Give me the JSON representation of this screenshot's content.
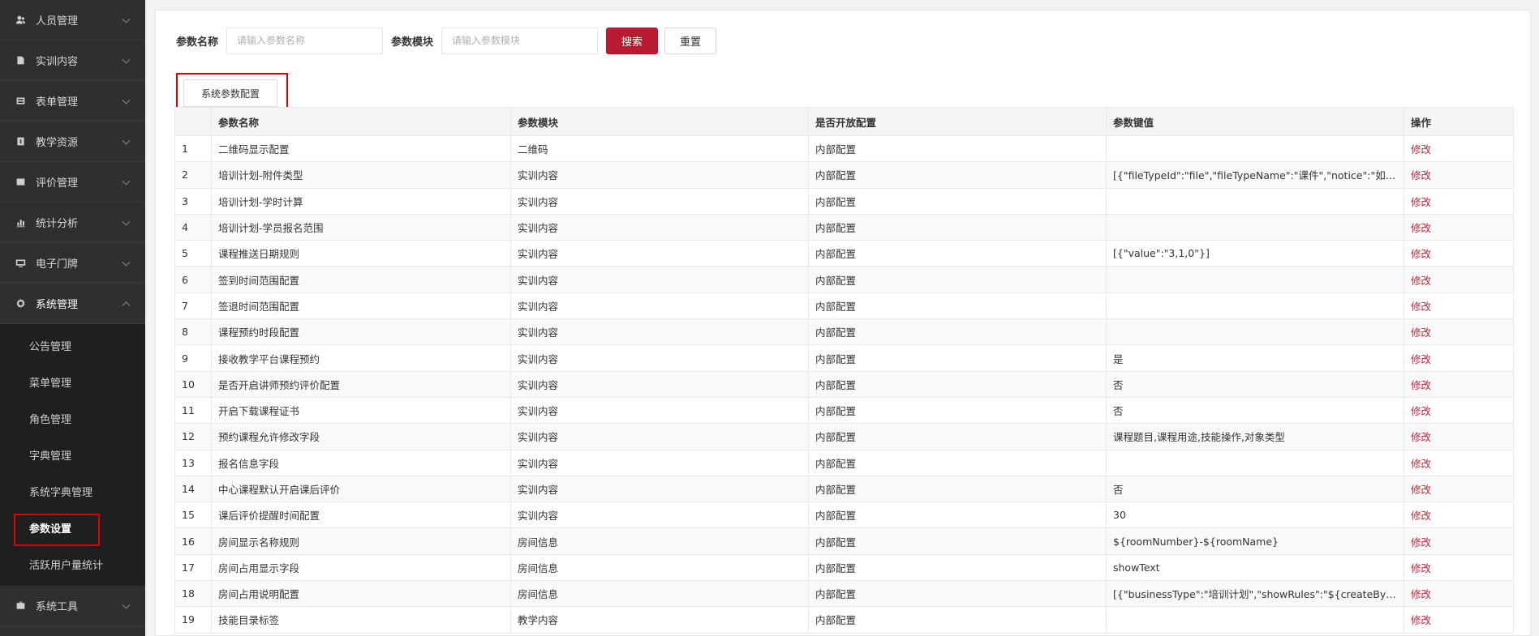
{
  "sidebar": {
    "items": [
      {
        "label": "人员管理",
        "icon": "user-icon"
      },
      {
        "label": "实训内容",
        "icon": "book-icon"
      },
      {
        "label": "表单管理",
        "icon": "form-icon"
      },
      {
        "label": "教学资源",
        "icon": "resource-icon"
      },
      {
        "label": "评价管理",
        "icon": "evaluate-icon"
      },
      {
        "label": "统计分析",
        "icon": "chart-icon"
      },
      {
        "label": "电子门牌",
        "icon": "monitor-icon"
      },
      {
        "label": "系统管理",
        "icon": "gear-icon"
      }
    ],
    "sub_items": [
      {
        "label": "公告管理"
      },
      {
        "label": "菜单管理"
      },
      {
        "label": "角色管理"
      },
      {
        "label": "字典管理"
      },
      {
        "label": "系统字典管理"
      },
      {
        "label": "参数设置"
      },
      {
        "label": "活跃用户量统计"
      }
    ],
    "tools": {
      "label": "系统工具",
      "icon": "toolbox-icon"
    }
  },
  "search": {
    "name_label": "参数名称",
    "name_placeholder": "请输入参数名称",
    "module_label": "参数模块",
    "module_placeholder": "请输入参数模块",
    "search_button": "搜索",
    "reset_button": "重置"
  },
  "config_button": "系统参数配置",
  "table": {
    "headers": [
      "",
      "参数名称",
      "参数模块",
      "是否开放配置",
      "参数键值",
      "操作"
    ],
    "action_label": "修改",
    "rows": [
      {
        "no": "1",
        "name": "二维码显示配置",
        "module": "二维码",
        "open": "内部配置",
        "value": ""
      },
      {
        "no": "2",
        "name": "培训计划-附件类型",
        "module": "实训内容",
        "open": "内部配置",
        "value": "[{\"fileTypeId\":\"file\",\"fileTypeName\":\"课件\",\"notice\":\"如有教案..."
      },
      {
        "no": "3",
        "name": "培训计划-学时计算",
        "module": "实训内容",
        "open": "内部配置",
        "value": ""
      },
      {
        "no": "4",
        "name": "培训计划-学员报名范围",
        "module": "实训内容",
        "open": "内部配置",
        "value": ""
      },
      {
        "no": "5",
        "name": "课程推送日期规则",
        "module": "实训内容",
        "open": "内部配置",
        "value": "[{\"value\":\"3,1,0\"}]"
      },
      {
        "no": "6",
        "name": "签到时间范围配置",
        "module": "实训内容",
        "open": "内部配置",
        "value": ""
      },
      {
        "no": "7",
        "name": "签退时间范围配置",
        "module": "实训内容",
        "open": "内部配置",
        "value": ""
      },
      {
        "no": "8",
        "name": "课程预约时段配置",
        "module": "实训内容",
        "open": "内部配置",
        "value": ""
      },
      {
        "no": "9",
        "name": "接收教学平台课程预约",
        "module": "实训内容",
        "open": "内部配置",
        "value": "是"
      },
      {
        "no": "10",
        "name": "是否开启讲师预约评价配置",
        "module": "实训内容",
        "open": "内部配置",
        "value": "否"
      },
      {
        "no": "11",
        "name": "开启下载课程证书",
        "module": "实训内容",
        "open": "内部配置",
        "value": "否"
      },
      {
        "no": "12",
        "name": "预约课程允许修改字段",
        "module": "实训内容",
        "open": "内部配置",
        "value": "课程题目,课程用途,技能操作,对象类型"
      },
      {
        "no": "13",
        "name": "报名信息字段",
        "module": "实训内容",
        "open": "内部配置",
        "value": ""
      },
      {
        "no": "14",
        "name": "中心课程默认开启课后评价",
        "module": "实训内容",
        "open": "内部配置",
        "value": "否"
      },
      {
        "no": "15",
        "name": "课后评价提醒时间配置",
        "module": "实训内容",
        "open": "内部配置",
        "value": "30"
      },
      {
        "no": "16",
        "name": "房间显示名称规则",
        "module": "房间信息",
        "open": "内部配置",
        "value": "${roomNumber}-${roomName}"
      },
      {
        "no": "17",
        "name": "房间占用显示字段",
        "module": "房间信息",
        "open": "内部配置",
        "value": "showText"
      },
      {
        "no": "18",
        "name": "房间占用说明配置",
        "module": "房间信息",
        "open": "内部配置",
        "value": "[{\"businessType\":\"培训计划\",\"showRules\":\"${createByName..."
      },
      {
        "no": "19",
        "name": "技能目录标签",
        "module": "教学内容",
        "open": "内部配置",
        "value": ""
      }
    ]
  }
}
